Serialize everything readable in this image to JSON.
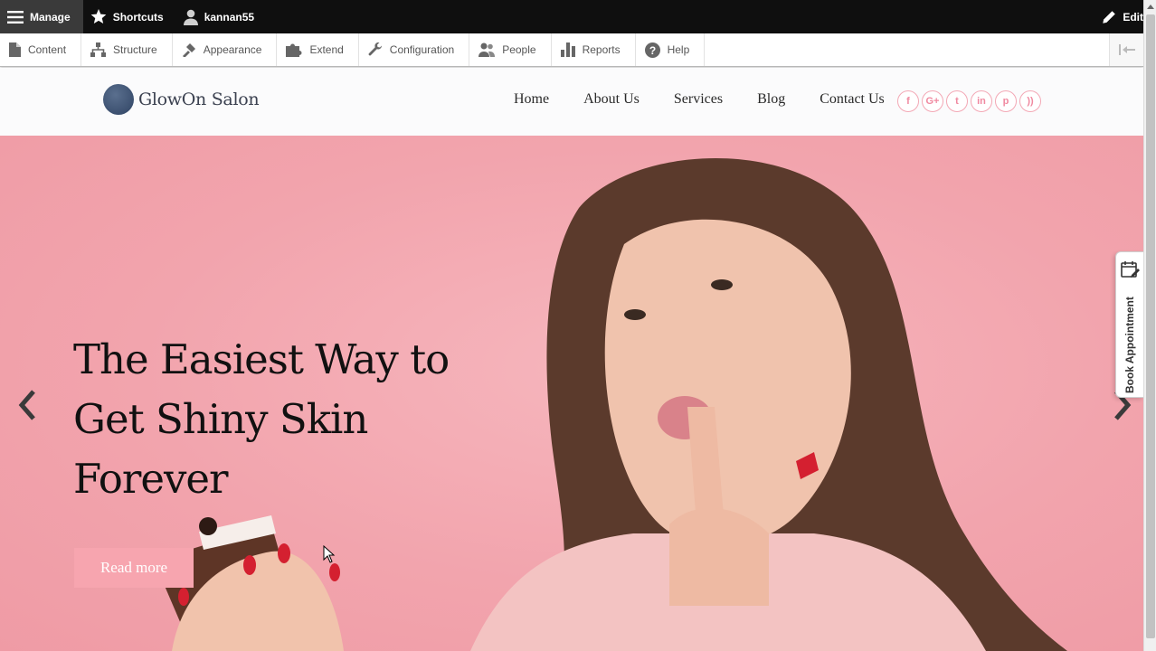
{
  "toolbar": {
    "manage_label": "Manage",
    "shortcuts_label": "Shortcuts",
    "user_label": "kannan55",
    "edit_label": "Edit"
  },
  "tray": {
    "items": [
      {
        "label": "Content",
        "icon": "page-icon"
      },
      {
        "label": "Structure",
        "icon": "sitemap-icon"
      },
      {
        "label": "Appearance",
        "icon": "paintbrush-icon"
      },
      {
        "label": "Extend",
        "icon": "puzzle-icon"
      },
      {
        "label": "Configuration",
        "icon": "wrench-icon"
      },
      {
        "label": "People",
        "icon": "people-icon"
      },
      {
        "label": "Reports",
        "icon": "bar-chart-icon"
      },
      {
        "label": "Help",
        "icon": "help-icon"
      }
    ]
  },
  "site": {
    "name": "GlowOn Salon",
    "nav": [
      "Home",
      "About Us",
      "Services",
      "Blog",
      "Contact Us"
    ],
    "socials": [
      {
        "icon": "facebook-icon",
        "glyph": "f"
      },
      {
        "icon": "google-plus-icon",
        "glyph": "G+"
      },
      {
        "icon": "twitter-icon",
        "glyph": "t"
      },
      {
        "icon": "linkedin-icon",
        "glyph": "in"
      },
      {
        "icon": "pinterest-icon",
        "glyph": "p"
      },
      {
        "icon": "rss-icon",
        "glyph": "))"
      }
    ]
  },
  "hero": {
    "title": "The Easiest Way to Get Shiny Skin Forever",
    "button_label": "Read more"
  },
  "book": {
    "label": "Book Appointment"
  },
  "colors": {
    "hero_bg": "#f2a4ad",
    "accent": "#f7a5af",
    "toolbar_bg": "#0f0f0f"
  }
}
